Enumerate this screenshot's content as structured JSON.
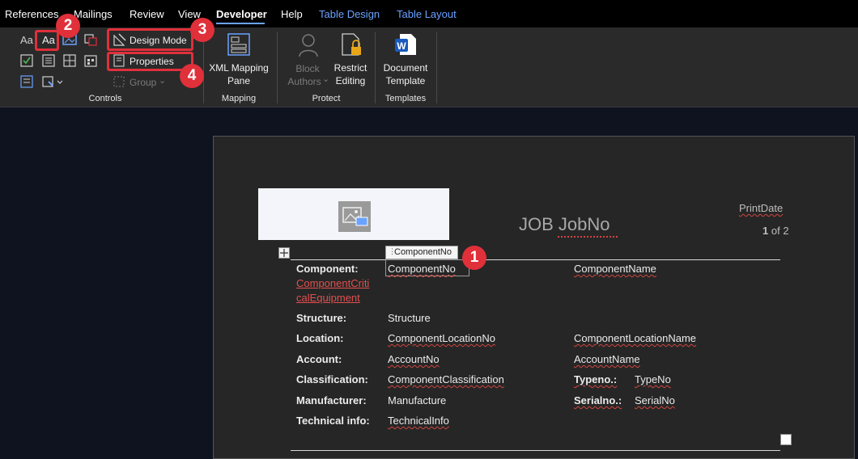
{
  "menu": {
    "tabs": [
      "References",
      "Mailings",
      "Review",
      "View",
      "Developer",
      "Help",
      "Table Design",
      "Table Layout"
    ],
    "active": "Developer"
  },
  "ribbon": {
    "controls": {
      "design_mode": "Design Mode",
      "properties": "Properties",
      "group": "Group",
      "label": "Controls",
      "text_control_icon": "Aa"
    },
    "mapping": {
      "xml_line1": "XML Mapping",
      "xml_line2": "Pane",
      "label": "Mapping"
    },
    "protect": {
      "block_line1": "Block",
      "block_line2": "Authors",
      "restrict_line1": "Restrict",
      "restrict_line2": "Editing",
      "label": "Protect"
    },
    "templates": {
      "doc_line1": "Document",
      "doc_line2": "Template",
      "label": "Templates"
    }
  },
  "callouts": [
    "1",
    "2",
    "3",
    "4"
  ],
  "document": {
    "title": "JOB JobNo",
    "print_date": "PrintDate",
    "page_current": "1",
    "page_rest": "of 2",
    "control_tag": "ComponentNo",
    "rows": [
      {
        "label": "Component:",
        "value": "ComponentNo",
        "extra": "ComponentName"
      },
      {
        "label": "Structure:",
        "value": "Structure"
      },
      {
        "label": "Location:",
        "value": "ComponentLocationNo",
        "extra": "ComponentLocationName"
      },
      {
        "label": "Account:",
        "value": "AccountNo",
        "extra": "AccountName"
      },
      {
        "label": "Classification:",
        "value": "ComponentClassification",
        "extra_label": "Typeno.:",
        "extra": "TypeNo"
      },
      {
        "label": "Manufacturer:",
        "value": "Manufacture",
        "extra_label": "Serialno.:",
        "extra": "SerialNo"
      },
      {
        "label": "Technical info:",
        "value": "TechnicalInfo"
      }
    ],
    "critical_line1": "ComponentCriti",
    "critical_line2": "calEquipment"
  },
  "colors": {
    "accent": "#6aa2ff",
    "highlight": "#e0303a",
    "critical": "#e2504f"
  }
}
